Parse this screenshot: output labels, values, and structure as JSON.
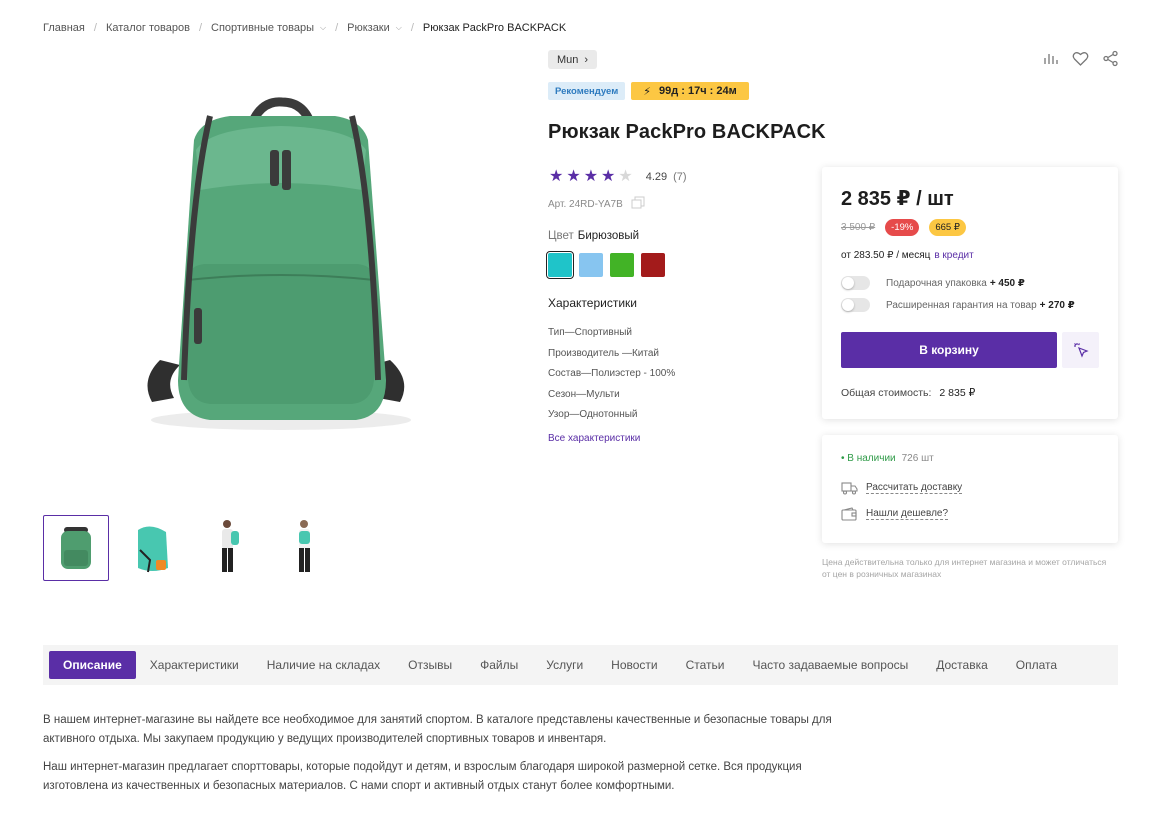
{
  "breadcrumb": {
    "items": [
      "Главная",
      "Каталог товаров",
      "Спортивные товары",
      "Рюкзаки"
    ],
    "current": "Рюкзак PackPro BACKPACK"
  },
  "product": {
    "brand": "Mun",
    "badge_recommend": "Рекомендуем",
    "timer": "99д : 17ч : 24м",
    "title": "Рюкзак PackPro BACKPACK",
    "rating_value": "4.29",
    "rating_stars": 4,
    "rating_count": "(7)",
    "sku": "Арт. 24RD-YA7B",
    "color_label": "Цвет",
    "color_value": "Бирюзовый",
    "swatches": [
      "#1fc4c9",
      "#87c5f0",
      "#42b326",
      "#a31b1b"
    ],
    "specs_title": "Характеристики",
    "specs": [
      "Тип—Спортивный",
      "Производитель —Китай",
      "Состав—Полиэстер - 100%",
      "Сезон—Мульти",
      "Узор—Однотонный"
    ],
    "all_specs_link": "Все характеристики"
  },
  "price": {
    "main": "2 835 ₽ / шт",
    "old": "3 500 ₽",
    "discount": "-19%",
    "bonus": "665 ₽",
    "credit_text": "от 283.50 ₽ / месяц",
    "credit_link": "в кредит",
    "option1_label": "Подарочная упаковка",
    "option1_price": "+ 450 ₽",
    "option2_label": "Расширенная гарантия на товар",
    "option2_price": "+ 270 ₽",
    "cart_button": "В корзину",
    "total_label": "Общая стоимость:",
    "total_value": "2 835 ₽"
  },
  "stock": {
    "status": "• В наличии",
    "qty": "726 шт",
    "delivery_link": "Рассчитать доставку",
    "cheaper_link": "Нашли дешевле?",
    "note": "Цена действительна только для интернет магазина и может отличаться от цен в розничных магазинах"
  },
  "tabs": [
    "Описание",
    "Характеристики",
    "Наличие на складах",
    "Отзывы",
    "Файлы",
    "Услуги",
    "Новости",
    "Статьи",
    "Часто задаваемые вопросы",
    "Доставка",
    "Оплата"
  ],
  "description": {
    "p1": "В нашем интернет-магазине вы найдете все необходимое для занятий спортом. В каталоге представлены качественные и безопасные товары для активного отдыха. Мы закупаем продукцию у ведущих производителей спортивных товаров и инвентаря.",
    "p2": "Наш интернет-магазин предлагает спорттовары, которые подойдут и детям, и взрослым благодаря широкой размерной сетке. Вся продукция изготовлена из качественных и безопасных материалов. С нами спорт и активный отдых станут более комфортными."
  },
  "colors": {
    "accent": "#5a2ea6",
    "timer": "#fcc743",
    "discount": "#e64b4b",
    "stock": "#2f9b48"
  }
}
